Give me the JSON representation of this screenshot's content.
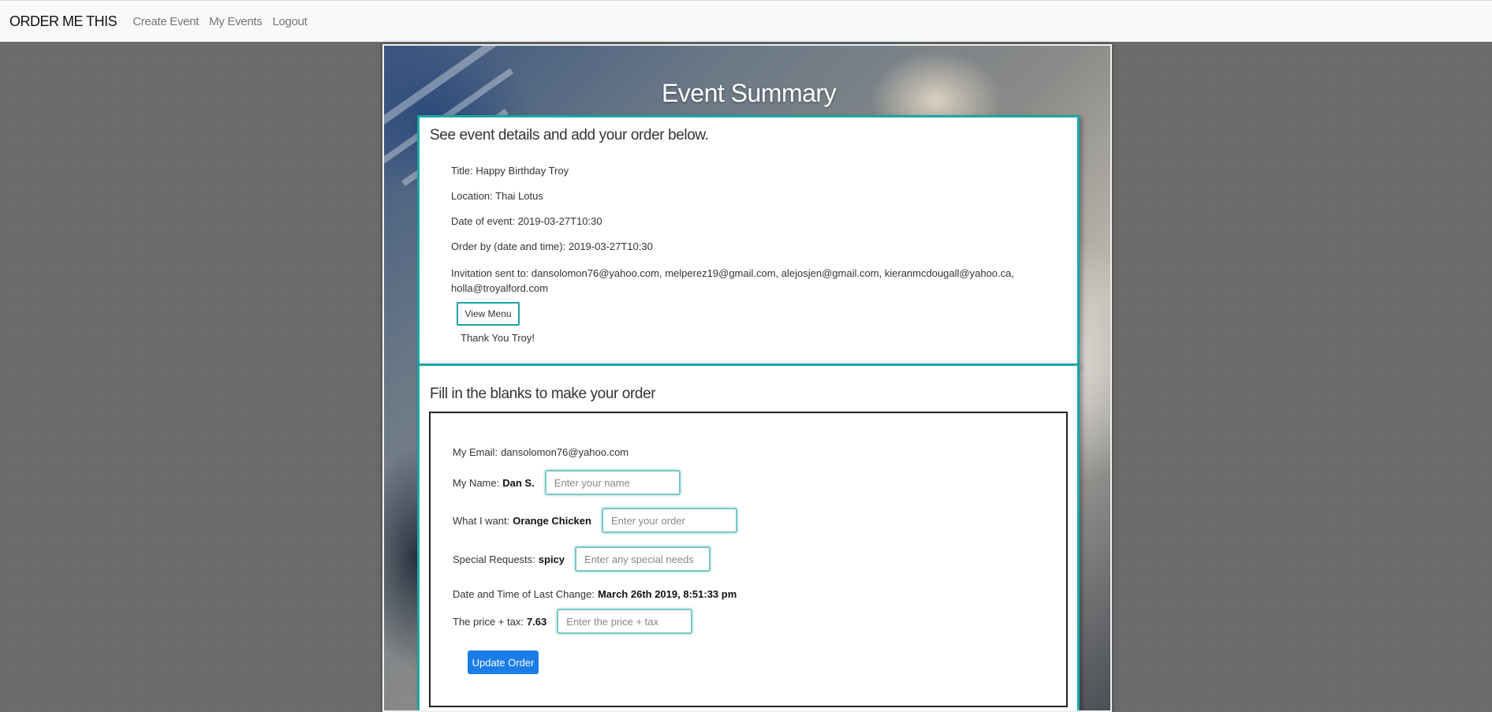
{
  "nav": {
    "brand": "ORDER ME THIS",
    "links": [
      "Create Event",
      "My Events",
      "Logout"
    ]
  },
  "page": {
    "title": "Event Summary"
  },
  "event_card": {
    "heading": "See event details and add your order below.",
    "details": [
      {
        "label": "Title:",
        "value": "Happy Birthday Troy"
      },
      {
        "label": "Location:",
        "value": "Thai Lotus"
      },
      {
        "label": "Date of event:",
        "value": "2019-03-27T10:30"
      },
      {
        "label": "Order by (date and time):",
        "value": "2019-03-27T10:30"
      },
      {
        "label": "Invitation sent to:",
        "value": "dansolomon76@yahoo.com, melperez19@gmail.com, alejosjen@gmail.com, kieranmcdougall@yahoo.ca,",
        "value2": "holla@troyalford.com"
      }
    ],
    "view_menu_label": "View Menu",
    "thanks": "Thank You Troy!"
  },
  "order_card": {
    "heading": "Fill in the blanks to make your order",
    "email_label": "My Email:",
    "email_value": "dansolomon76@yahoo.com",
    "name_label": "My Name:",
    "name_value": "Dan S.",
    "name_placeholder": "Enter your name",
    "want_label": "What I want:",
    "want_value": "Orange Chicken",
    "want_placeholder": "Enter your order",
    "special_label": "Special Requests:",
    "special_value": "spicy",
    "special_placeholder": "Enter any special needs",
    "changed_label": "Date and Time of Last Change:",
    "changed_value": "March 26th 2019, 8:51:33 pm",
    "price_label": "The price + tax:",
    "price_value": "7.63",
    "price_placeholder": "Enter the price + tax",
    "update_label": "Update Order"
  },
  "colors": {
    "accent": "#1aa6a6",
    "primary": "#1a7de8",
    "navbar_bg": "#f8f9fa"
  }
}
